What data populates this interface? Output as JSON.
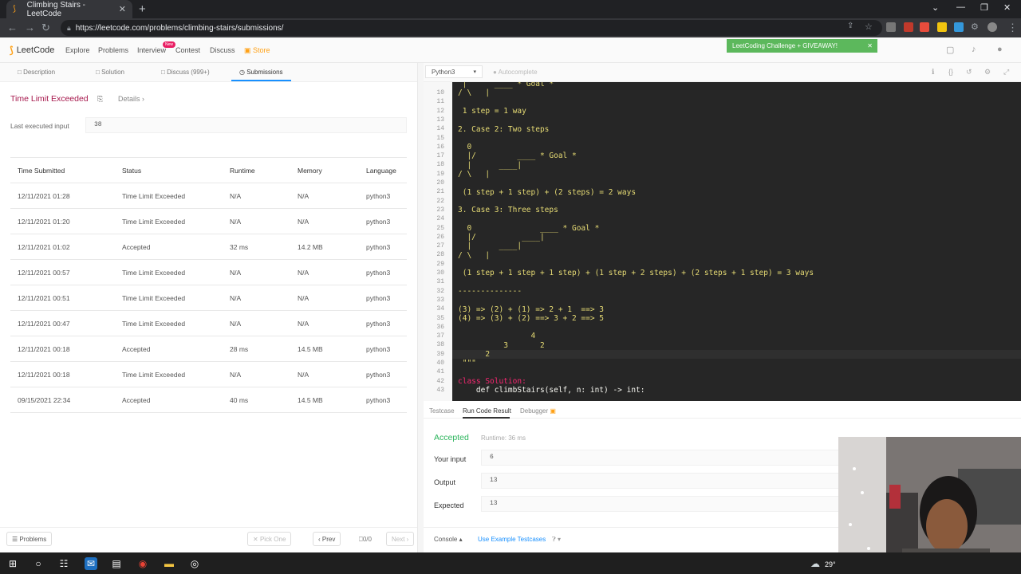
{
  "browser": {
    "tab_title": "Climbing Stairs - LeetCode",
    "url": "https://leetcode.com/problems/climbing-stairs/submissions/"
  },
  "nav": {
    "logo": "LeetCode",
    "links": [
      "Explore",
      "Problems",
      "Interview",
      "Contest",
      "Discuss",
      "Store"
    ],
    "new_badge": "New",
    "challenge": "LeetCoding Challenge + GIVEAWAY!"
  },
  "left_tabs": [
    "Description",
    "Solution",
    "Discuss (999+)",
    "Submissions"
  ],
  "result": {
    "status": "Time Limit Exceeded",
    "details": "Details",
    "last_input_label": "Last executed input",
    "last_input": "38"
  },
  "table": {
    "headers": [
      "Time Submitted",
      "Status",
      "Runtime",
      "Memory",
      "Language"
    ],
    "rows": [
      [
        "12/11/2021 01:28",
        "Time Limit Exceeded",
        "N/A",
        "N/A",
        "python3"
      ],
      [
        "12/11/2021 01:20",
        "Time Limit Exceeded",
        "N/A",
        "N/A",
        "python3"
      ],
      [
        "12/11/2021 01:02",
        "Accepted",
        "32 ms",
        "14.2 MB",
        "python3"
      ],
      [
        "12/11/2021 00:57",
        "Time Limit Exceeded",
        "N/A",
        "N/A",
        "python3"
      ],
      [
        "12/11/2021 00:51",
        "Time Limit Exceeded",
        "N/A",
        "N/A",
        "python3"
      ],
      [
        "12/11/2021 00:47",
        "Time Limit Exceeded",
        "N/A",
        "N/A",
        "python3"
      ],
      [
        "12/11/2021 00:18",
        "Accepted",
        "28 ms",
        "14.5 MB",
        "python3"
      ],
      [
        "12/11/2021 00:18",
        "Time Limit Exceeded",
        "N/A",
        "N/A",
        "python3"
      ],
      [
        "09/15/2021 22:34",
        "Accepted",
        "40 ms",
        "14.5 MB",
        "python3"
      ]
    ]
  },
  "left_bottom": {
    "problems": "Problems",
    "pick_one": "Pick One",
    "prev": "Prev",
    "page": "0/0",
    "next": "Next"
  },
  "editor": {
    "language": "Python3",
    "autocomplete": "Autocomplete",
    "line_numbers": [
      "10",
      "11",
      "12",
      "13",
      "14",
      "15",
      "16",
      "17",
      "18",
      "19",
      "20",
      "21",
      "22",
      "23",
      "24",
      "25",
      "26",
      "27",
      "28",
      "29",
      "30",
      "31",
      "32",
      "33",
      "34",
      "35",
      "36",
      "37",
      "38",
      "39",
      "40",
      "41",
      "42",
      "43"
    ],
    "lines": [
      " |      ____ * Goal *",
      "/ \\   |",
      "",
      " 1 step = 1 way",
      "",
      "2. Case 2: Two steps",
      "",
      "  0",
      "  |/         ____ * Goal *",
      "  |      ____|",
      "/ \\   |",
      "",
      " (1 step + 1 step) + (2 steps) = 2 ways",
      "",
      "3. Case 3: Three steps",
      "",
      "  0               ____ * Goal *",
      "  |/          ____|",
      "  |      ____|",
      "/ \\   |",
      "",
      " (1 step + 1 step + 1 step) + (1 step + 2 steps) + (2 steps + 1 step) = 3 ways",
      "",
      "--------------",
      "",
      "(3) => (2) + (1) => 2 + 1  ==> 3",
      "(4) => (3) + (2) ==> 3 + 2 ==> 5",
      "",
      "                4",
      "          3       2",
      "      2",
      " \"\"\"",
      "",
      "class Solution:",
      "    def climbStairs(self, n: int) -> int:"
    ]
  },
  "console": {
    "tabs": [
      "Testcase",
      "Run Code Result",
      "Debugger"
    ],
    "status": "Accepted",
    "runtime": "Runtime: 36 ms",
    "input_label": "Your input",
    "input": "6",
    "output_label": "Output",
    "output": "13",
    "expected_label": "Expected",
    "expected": "13",
    "console_btn": "Console",
    "use_example": "Use Example Testcases"
  },
  "taskbar": {
    "temperature": "29°"
  }
}
